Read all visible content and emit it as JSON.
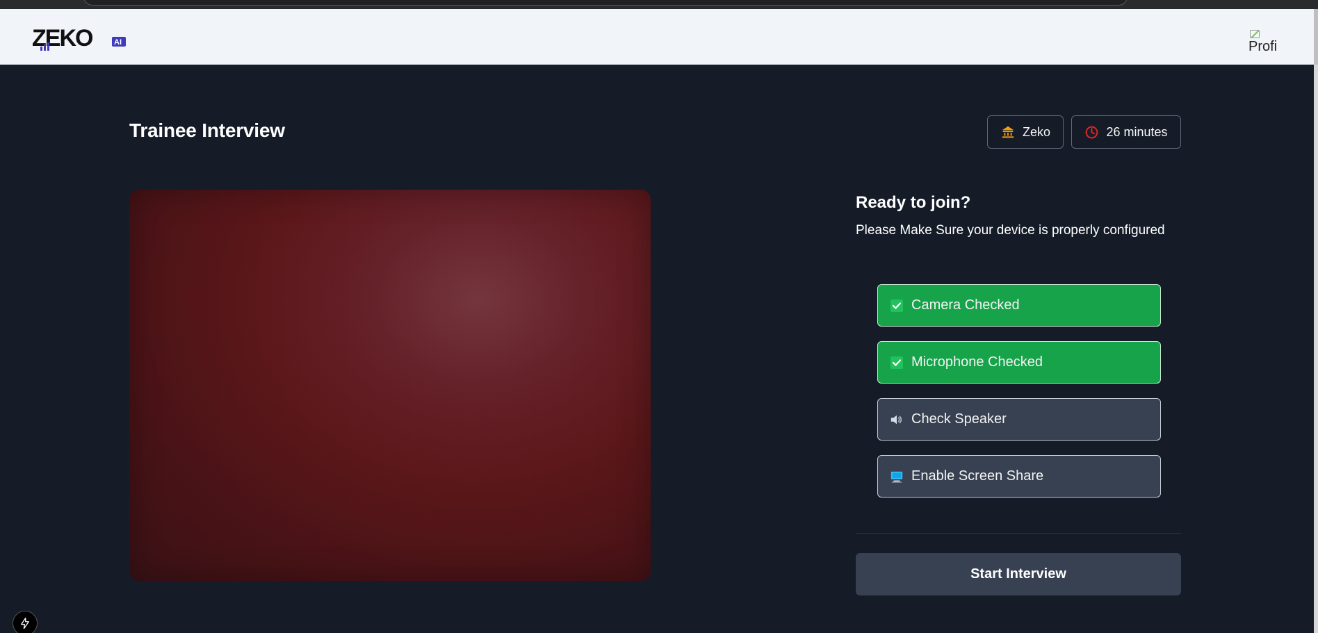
{
  "header": {
    "logo_text": "ZEKO",
    "logo_badge": "AI",
    "profile_alt": "Profi"
  },
  "interview": {
    "title": "Trainee Interview",
    "company": "Zeko",
    "duration": "26 minutes"
  },
  "ready": {
    "title": "Ready to join?",
    "subtitle": "Please Make Sure your device is properly configured"
  },
  "device_checks": [
    {
      "label": "Camera Checked",
      "status": "checked",
      "icon": "check-icon"
    },
    {
      "label": "Microphone Checked",
      "status": "checked",
      "icon": "check-icon"
    },
    {
      "label": "Check Speaker",
      "status": "pending",
      "icon": "speaker-icon"
    },
    {
      "label": "Enable Screen Share",
      "status": "pending",
      "icon": "monitor-icon"
    }
  ],
  "actions": {
    "start_label": "Start Interview"
  },
  "colors": {
    "background": "#151b27",
    "header": "#f1f4f8",
    "success": "#16a34a",
    "pending_button": "#374151",
    "company_icon": "#f59e0b",
    "timer_icon": "#dc2626"
  }
}
